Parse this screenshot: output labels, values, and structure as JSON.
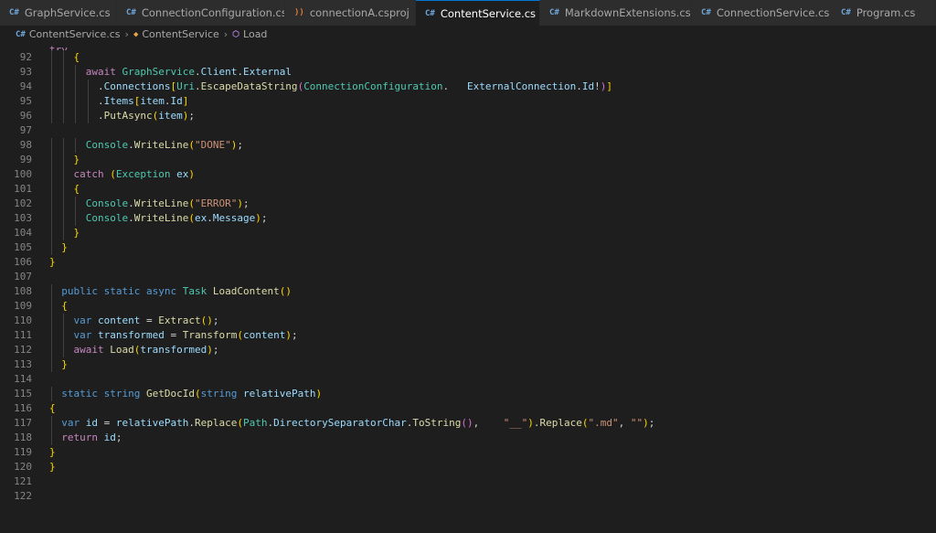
{
  "tabs": [
    {
      "label": "GraphService.cs",
      "icon": "csharp-icon",
      "active": false
    },
    {
      "label": "ConnectionConfiguration.cs",
      "icon": "csharp-icon",
      "active": false
    },
    {
      "label": "connectionA.csproj",
      "icon": "rss-icon",
      "active": false
    },
    {
      "label": "ContentService.cs",
      "icon": "csharp-icon",
      "active": true
    },
    {
      "label": "MarkdownExtensions.cs",
      "icon": "csharp-icon",
      "active": false
    },
    {
      "label": "ConnectionService.cs",
      "icon": "csharp-icon",
      "active": false
    },
    {
      "label": "Program.cs",
      "icon": "csharp-icon",
      "active": false
    }
  ],
  "breadcrumb": {
    "file": "ContentService.cs",
    "class": "ContentService",
    "method": "Load"
  },
  "lines": [
    {
      "n": "92",
      "text": "    {"
    },
    {
      "n": "93",
      "text": "      await GraphService.Client.External"
    },
    {
      "n": "94",
      "text": "        .Connections[Uri.EscapeDataString(ConnectionConfiguration.   ExternalConnection.Id!)]"
    },
    {
      "n": "95",
      "text": "        .Items[item.Id]"
    },
    {
      "n": "96",
      "text": "        .PutAsync(item);"
    },
    {
      "n": "97",
      "text": ""
    },
    {
      "n": "98",
      "text": "      Console.WriteLine(\"DONE\");"
    },
    {
      "n": "99",
      "text": "    }"
    },
    {
      "n": "100",
      "text": "    catch (Exception ex)"
    },
    {
      "n": "101",
      "text": "    {"
    },
    {
      "n": "102",
      "text": "      Console.WriteLine(\"ERROR\");"
    },
    {
      "n": "103",
      "text": "      Console.WriteLine(ex.Message);"
    },
    {
      "n": "104",
      "text": "    }"
    },
    {
      "n": "105",
      "text": "  }"
    },
    {
      "n": "106",
      "text": "}"
    },
    {
      "n": "107",
      "text": ""
    },
    {
      "n": "108",
      "text": "  public static async Task LoadContent()"
    },
    {
      "n": "109",
      "text": "  {"
    },
    {
      "n": "110",
      "text": "    var content = Extract();"
    },
    {
      "n": "111",
      "text": "    var transformed = Transform(content);"
    },
    {
      "n": "112",
      "text": "    await Load(transformed);"
    },
    {
      "n": "113",
      "text": "  }"
    },
    {
      "n": "114",
      "text": ""
    },
    {
      "n": "115",
      "text": "  static string GetDocId(string relativePath)"
    },
    {
      "n": "116",
      "text": "{"
    },
    {
      "n": "117",
      "text": "  var id = relativePath.Replace(Path.DirectorySeparatorChar.ToString(),    \"__\").Replace(\".md\", \"\");"
    },
    {
      "n": "118",
      "text": "  return id;"
    },
    {
      "n": "119",
      "text": "}"
    },
    {
      "n": "120",
      "text": "}"
    },
    {
      "n": "121",
      "text": ""
    },
    {
      "n": "122",
      "text": ""
    }
  ],
  "partial_top_line": "    try"
}
